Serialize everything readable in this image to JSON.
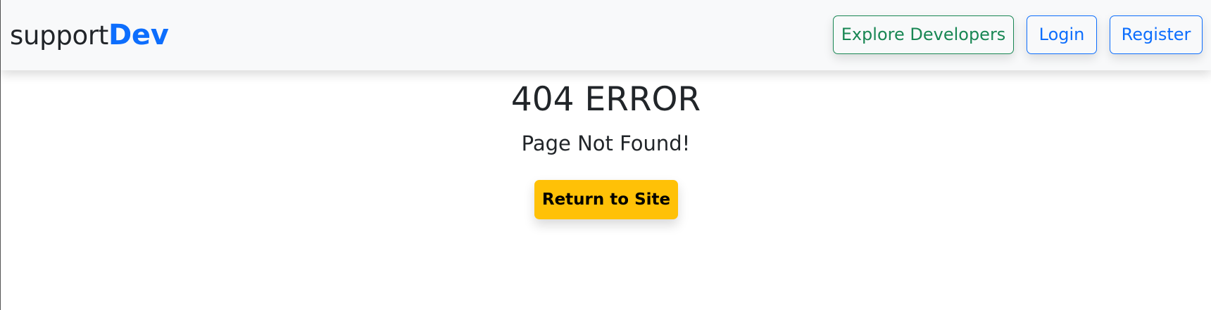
{
  "navbar": {
    "brand_prefix": "support",
    "brand_accent": "Dev",
    "buttons": {
      "explore": "Explore Developers",
      "login": "Login",
      "register": "Register"
    }
  },
  "main": {
    "error_title": "404 ERROR",
    "error_message": "Page Not Found!",
    "return_button": "Return to Site"
  },
  "colors": {
    "navbar_background": "#f8f9fa",
    "brand_accent": "#0d6efd",
    "explore_button": "#198754",
    "login_register_buttons": "#0d6efd",
    "return_button_background": "#ffc107",
    "text": "#212529"
  }
}
